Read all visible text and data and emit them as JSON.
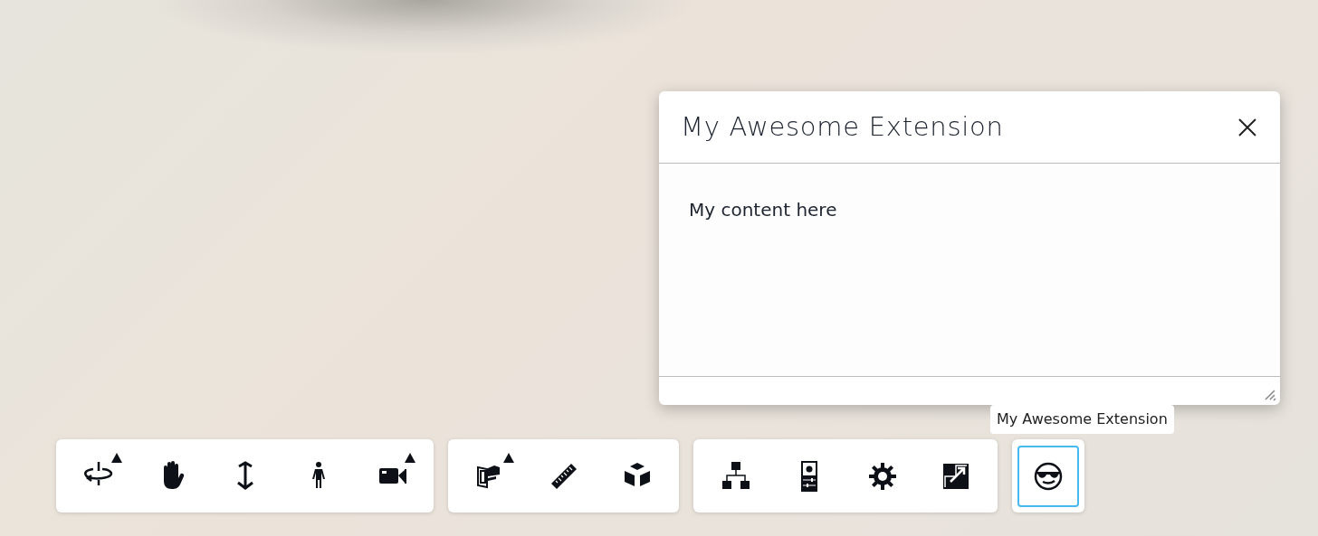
{
  "panel": {
    "title": "My Awesome Extension",
    "content": "My content here"
  },
  "tooltip": "My Awesome Extension",
  "toolbar": [
    {
      "buttons": [
        {
          "kind": "orbit",
          "has_menu": true,
          "selected": false
        },
        {
          "kind": "pan",
          "has_menu": false,
          "selected": false
        },
        {
          "kind": "zoom",
          "has_menu": false,
          "selected": false
        },
        {
          "kind": "walk",
          "has_menu": false,
          "selected": false
        },
        {
          "kind": "camera",
          "has_menu": true,
          "selected": false
        }
      ]
    },
    {
      "buttons": [
        {
          "kind": "section",
          "has_menu": true,
          "selected": false
        },
        {
          "kind": "measure",
          "has_menu": false,
          "selected": false
        },
        {
          "kind": "explode",
          "has_menu": false,
          "selected": false
        }
      ]
    },
    {
      "buttons": [
        {
          "kind": "tree",
          "has_menu": false,
          "selected": false
        },
        {
          "kind": "properties",
          "has_menu": false,
          "selected": false
        },
        {
          "kind": "settings",
          "has_menu": false,
          "selected": false
        },
        {
          "kind": "fullscreen",
          "has_menu": false,
          "selected": false
        }
      ]
    },
    {
      "buttons": [
        {
          "kind": "extension",
          "has_menu": false,
          "selected": true
        }
      ]
    }
  ]
}
